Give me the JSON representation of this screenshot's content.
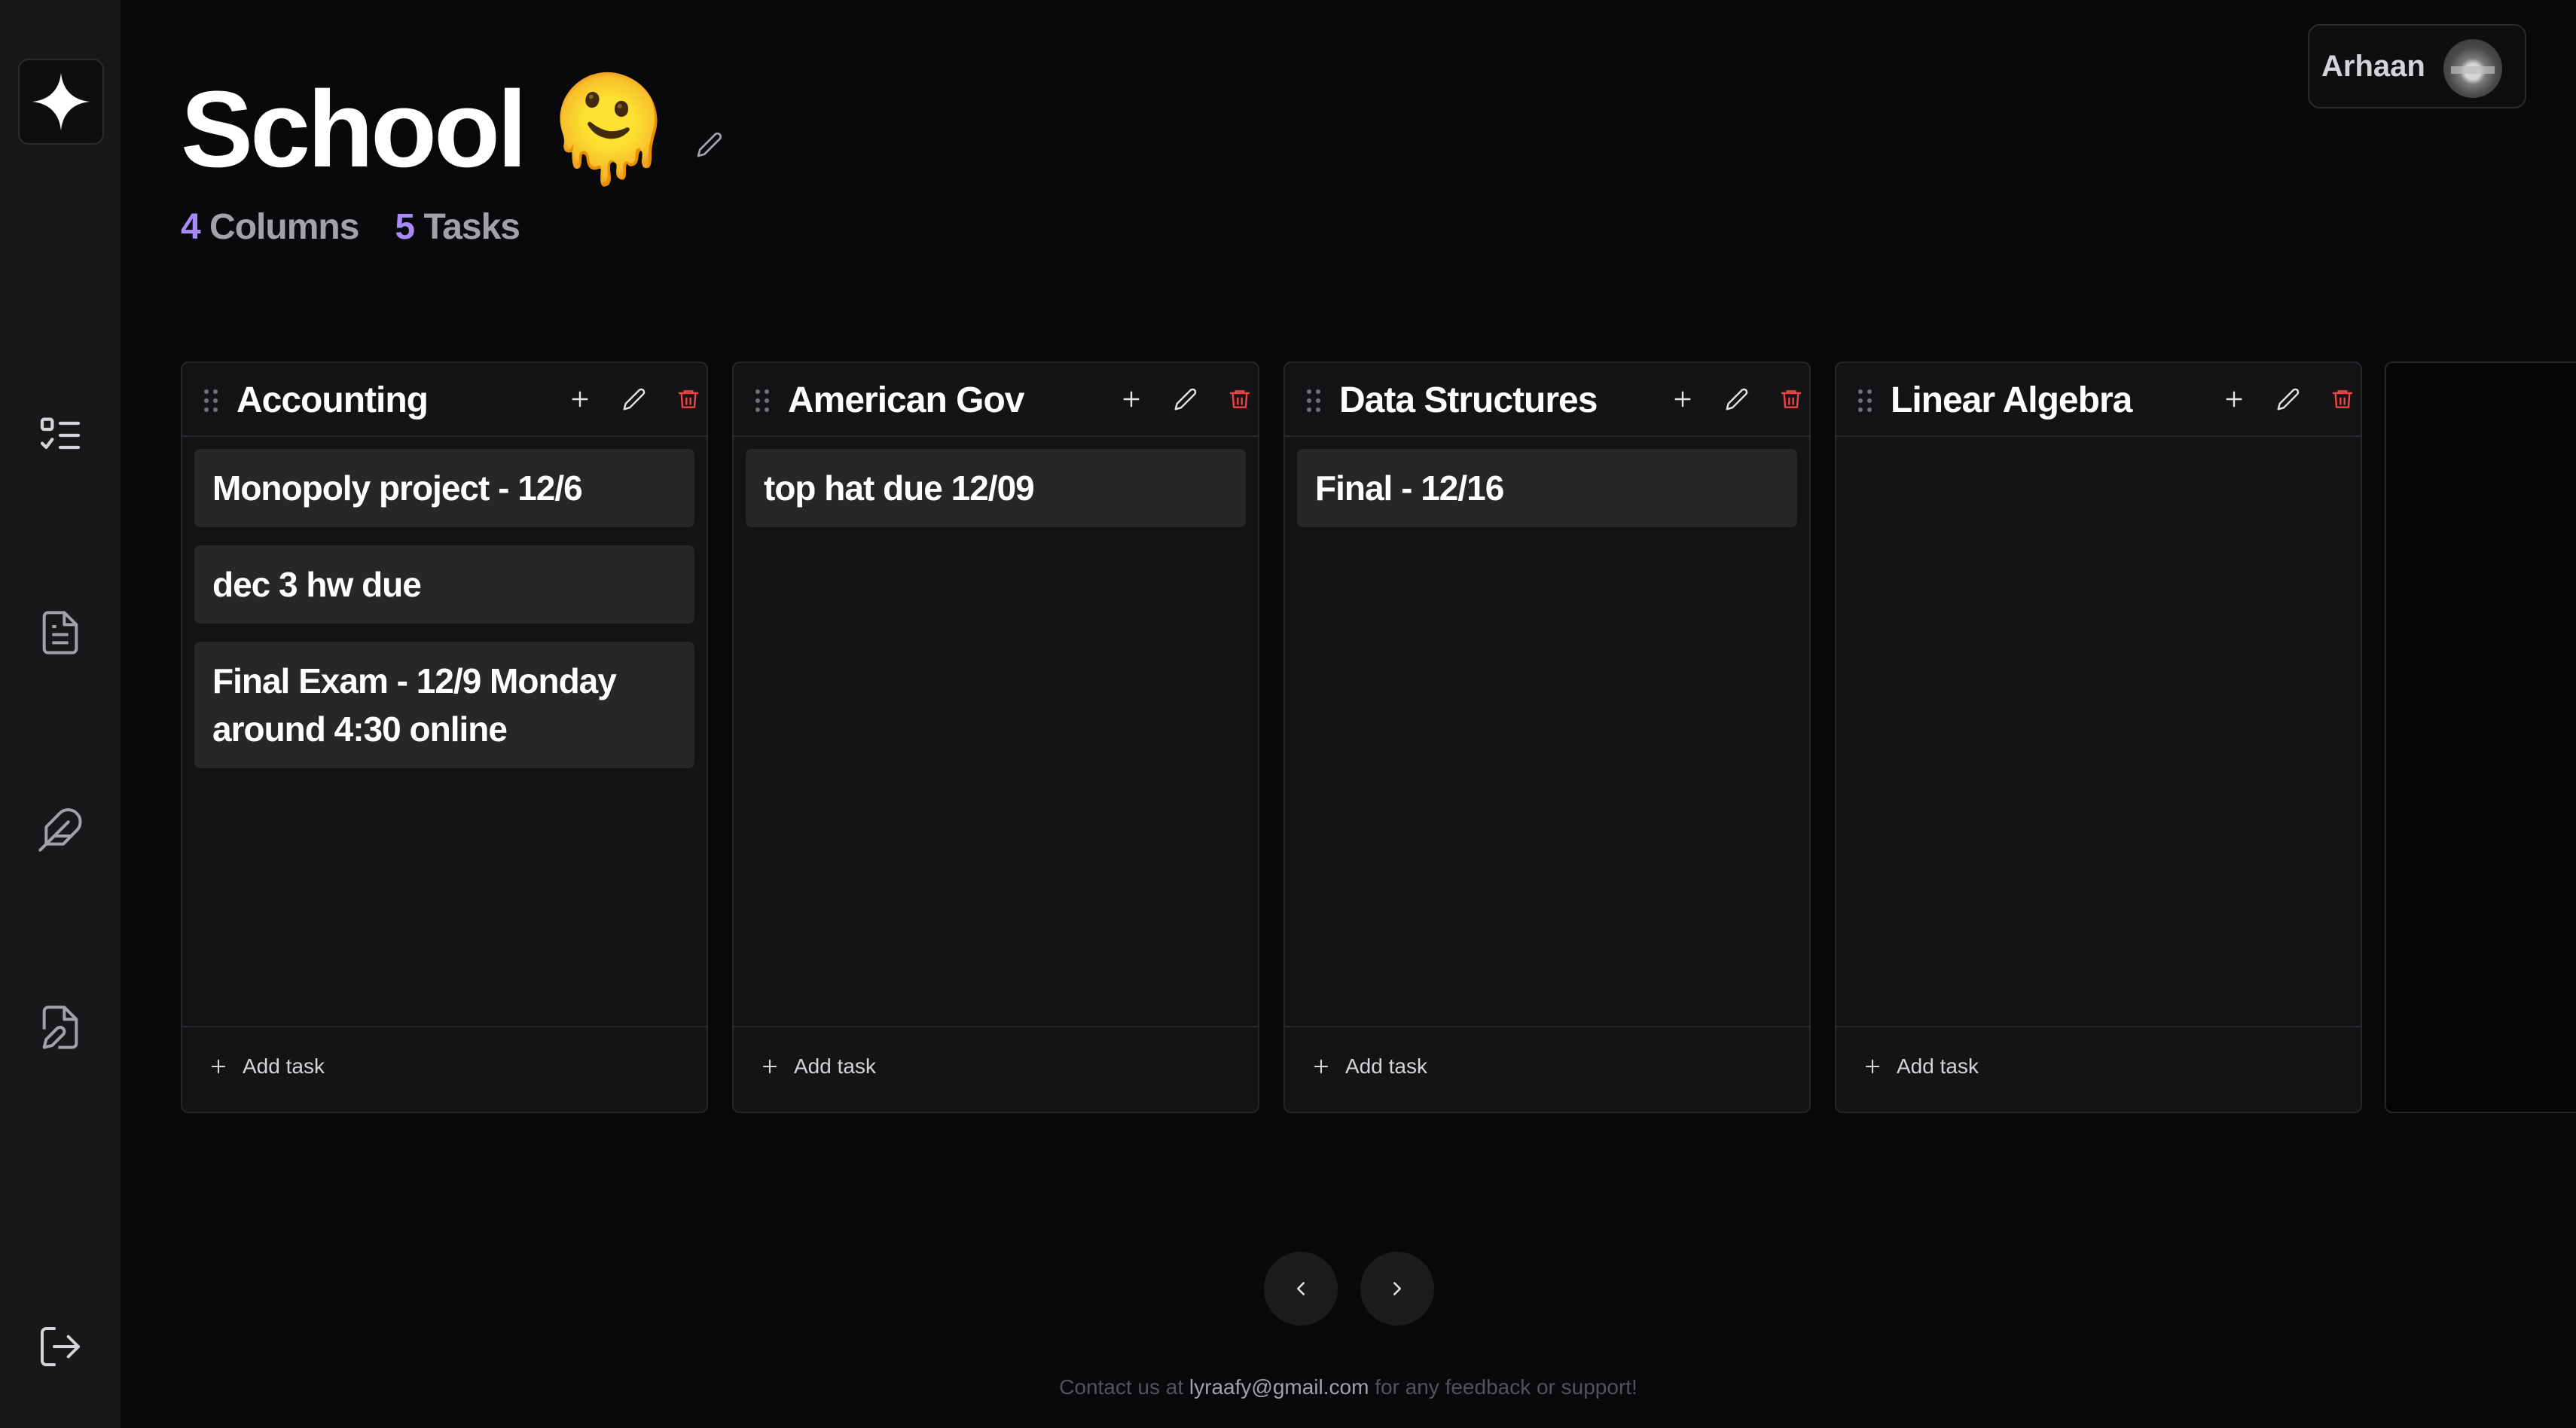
{
  "board": {
    "title": "School",
    "emoji": "🫠",
    "stats": {
      "columns_count": "4",
      "columns_label": "Columns",
      "tasks_count": "5",
      "tasks_label": "Tasks"
    }
  },
  "user": {
    "name": "Arhaan"
  },
  "columns": [
    {
      "title": "Accounting",
      "tasks": [
        "Monopoly project - 12/6",
        "dec 3 hw due",
        "Final Exam - 12/9 Monday around 4:30 online"
      ],
      "add_label": "Add task"
    },
    {
      "title": "American Gov",
      "tasks": [
        "top hat due 12/09"
      ],
      "add_label": "Add task"
    },
    {
      "title": "Data Structures",
      "tasks": [
        "Final - 12/16"
      ],
      "add_label": "Add task"
    },
    {
      "title": "Linear Algebra",
      "tasks": [],
      "add_label": "Add task"
    }
  ],
  "footer": {
    "prefix": "Contact us at",
    "email": "lyraafy@gmail.com",
    "suffix": "for any feedback or support!"
  },
  "colors": {
    "accent": "#a78bfa",
    "danger": "#ef4444",
    "background": "#09090b",
    "card": "#27272a"
  },
  "icons": {
    "sidebar": [
      "sparkle-logo-icon",
      "task-list-icon",
      "document-icon",
      "feather-icon",
      "file-edit-icon",
      "logout-icon"
    ],
    "column_actions": [
      "plus-icon",
      "pencil-icon",
      "trash-icon"
    ],
    "pager": [
      "chevron-left-icon",
      "chevron-right-icon"
    ]
  }
}
